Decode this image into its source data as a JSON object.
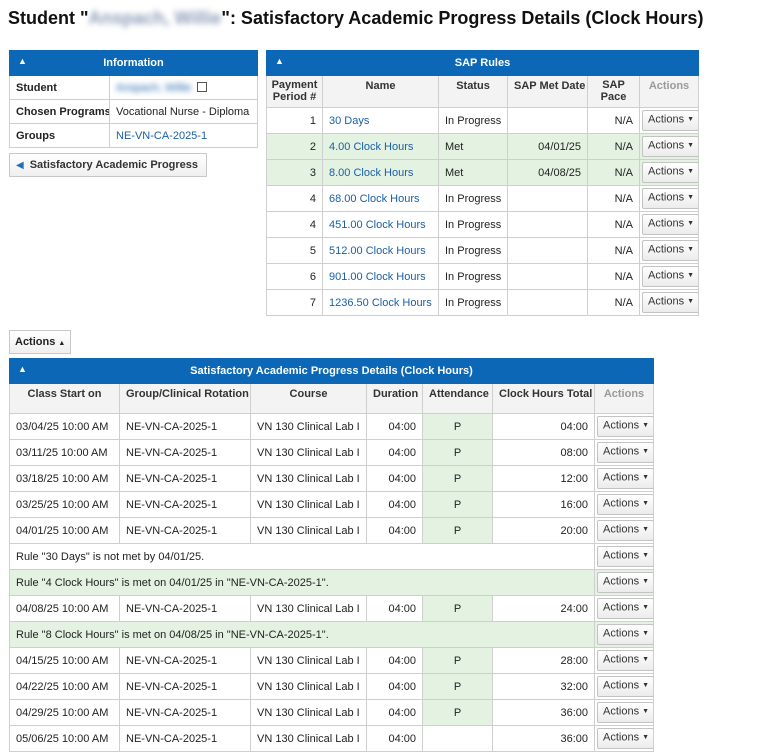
{
  "title": {
    "prefix": "Student \"",
    "student_name": "Anspach, Willie",
    "suffix": "\": Satisfactory Academic Progress Details (Clock Hours)"
  },
  "collapse_icon": "chevron-up-icon",
  "info": {
    "header": "Information",
    "student_label": "Student",
    "student_value": "Anspach, Willie",
    "programs_label": "Chosen Programs",
    "programs_value": "Vocational Nurse - Diploma",
    "groups_label": "Groups",
    "groups_value": "NE-VN-CA-2025-1"
  },
  "back_button": {
    "label": "Satisfactory Academic Progress"
  },
  "sap_rules": {
    "header": "SAP Rules",
    "columns": [
      "Payment Period #",
      "Name",
      "Status",
      "SAP Met Date",
      "SAP Pace",
      "Actions"
    ],
    "rows": [
      {
        "period": "1",
        "name": "30 Days",
        "status": "In Progress",
        "met_date": "",
        "pace": "N/A",
        "action": "Actions",
        "met": false
      },
      {
        "period": "2",
        "name": "4.00 Clock Hours",
        "status": "Met",
        "met_date": "04/01/25",
        "pace": "N/A",
        "action": "Actions",
        "met": true
      },
      {
        "period": "3",
        "name": "8.00 Clock Hours",
        "status": "Met",
        "met_date": "04/08/25",
        "pace": "N/A",
        "action": "Actions",
        "met": true
      },
      {
        "period": "4",
        "name": "68.00 Clock Hours",
        "status": "In Progress",
        "met_date": "",
        "pace": "N/A",
        "action": "Actions",
        "met": false
      },
      {
        "period": "4",
        "name": "451.00 Clock Hours",
        "status": "In Progress",
        "met_date": "",
        "pace": "N/A",
        "action": "Actions",
        "met": false
      },
      {
        "period": "5",
        "name": "512.00 Clock Hours",
        "status": "In Progress",
        "met_date": "",
        "pace": "N/A",
        "action": "Actions",
        "met": false
      },
      {
        "period": "6",
        "name": "901.00 Clock Hours",
        "status": "In Progress",
        "met_date": "",
        "pace": "N/A",
        "action": "Actions",
        "met": false
      },
      {
        "period": "7",
        "name": "1236.50 Clock Hours",
        "status": "In Progress",
        "met_date": "",
        "pace": "N/A",
        "action": "Actions",
        "met": false
      }
    ]
  },
  "actions_button": {
    "label": "Actions"
  },
  "details": {
    "header": "Satisfactory Academic Progress Details (Clock Hours)",
    "columns": [
      "Class Start on",
      "Group/Clinical Rotation",
      "Course",
      "Duration",
      "Attendance",
      "Clock Hours Total",
      "Actions"
    ],
    "rows": [
      {
        "type": "class",
        "start": "03/04/25 10:00 AM",
        "group": "NE-VN-CA-2025-1",
        "course": "VN 130 Clinical Lab I",
        "duration": "04:00",
        "attendance": "P",
        "total": "04:00",
        "action": "Actions"
      },
      {
        "type": "class",
        "start": "03/11/25 10:00 AM",
        "group": "NE-VN-CA-2025-1",
        "course": "VN 130 Clinical Lab I",
        "duration": "04:00",
        "attendance": "P",
        "total": "08:00",
        "action": "Actions"
      },
      {
        "type": "class",
        "start": "03/18/25 10:00 AM",
        "group": "NE-VN-CA-2025-1",
        "course": "VN 130 Clinical Lab I",
        "duration": "04:00",
        "attendance": "P",
        "total": "12:00",
        "action": "Actions"
      },
      {
        "type": "class",
        "start": "03/25/25 10:00 AM",
        "group": "NE-VN-CA-2025-1",
        "course": "VN 130 Clinical Lab I",
        "duration": "04:00",
        "attendance": "P",
        "total": "16:00",
        "action": "Actions"
      },
      {
        "type": "class",
        "start": "04/01/25 10:00 AM",
        "group": "NE-VN-CA-2025-1",
        "course": "VN 130 Clinical Lab I",
        "duration": "04:00",
        "attendance": "P",
        "total": "20:00",
        "action": "Actions"
      },
      {
        "type": "note",
        "text": "Rule \"30 Days\" is not met by 04/01/25.",
        "met": false,
        "action": "Actions"
      },
      {
        "type": "note",
        "text": "Rule \"4 Clock Hours\" is met on 04/01/25 in \"NE-VN-CA-2025-1\".",
        "met": true,
        "action": "Actions"
      },
      {
        "type": "class",
        "start": "04/08/25 10:00 AM",
        "group": "NE-VN-CA-2025-1",
        "course": "VN 130 Clinical Lab I",
        "duration": "04:00",
        "attendance": "P",
        "total": "24:00",
        "action": "Actions"
      },
      {
        "type": "note",
        "text": "Rule \"8 Clock Hours\" is met on 04/08/25 in \"NE-VN-CA-2025-1\".",
        "met": true,
        "action": "Actions"
      },
      {
        "type": "class",
        "start": "04/15/25 10:00 AM",
        "group": "NE-VN-CA-2025-1",
        "course": "VN 130 Clinical Lab I",
        "duration": "04:00",
        "attendance": "P",
        "total": "28:00",
        "action": "Actions"
      },
      {
        "type": "class",
        "start": "04/22/25 10:00 AM",
        "group": "NE-VN-CA-2025-1",
        "course": "VN 130 Clinical Lab I",
        "duration": "04:00",
        "attendance": "P",
        "total": "32:00",
        "action": "Actions"
      },
      {
        "type": "class",
        "start": "04/29/25 10:00 AM",
        "group": "NE-VN-CA-2025-1",
        "course": "VN 130 Clinical Lab I",
        "duration": "04:00",
        "attendance": "P",
        "total": "36:00",
        "action": "Actions"
      },
      {
        "type": "class",
        "start": "05/06/25 10:00 AM",
        "group": "NE-VN-CA-2025-1",
        "course": "VN 130 Clinical Lab I",
        "duration": "04:00",
        "attendance": "",
        "total": "36:00",
        "action": "Actions"
      }
    ]
  },
  "colors": {
    "header_blue": "#0c68b6",
    "met_green": "#e4f2e2",
    "link_blue": "#1a5fa8"
  }
}
